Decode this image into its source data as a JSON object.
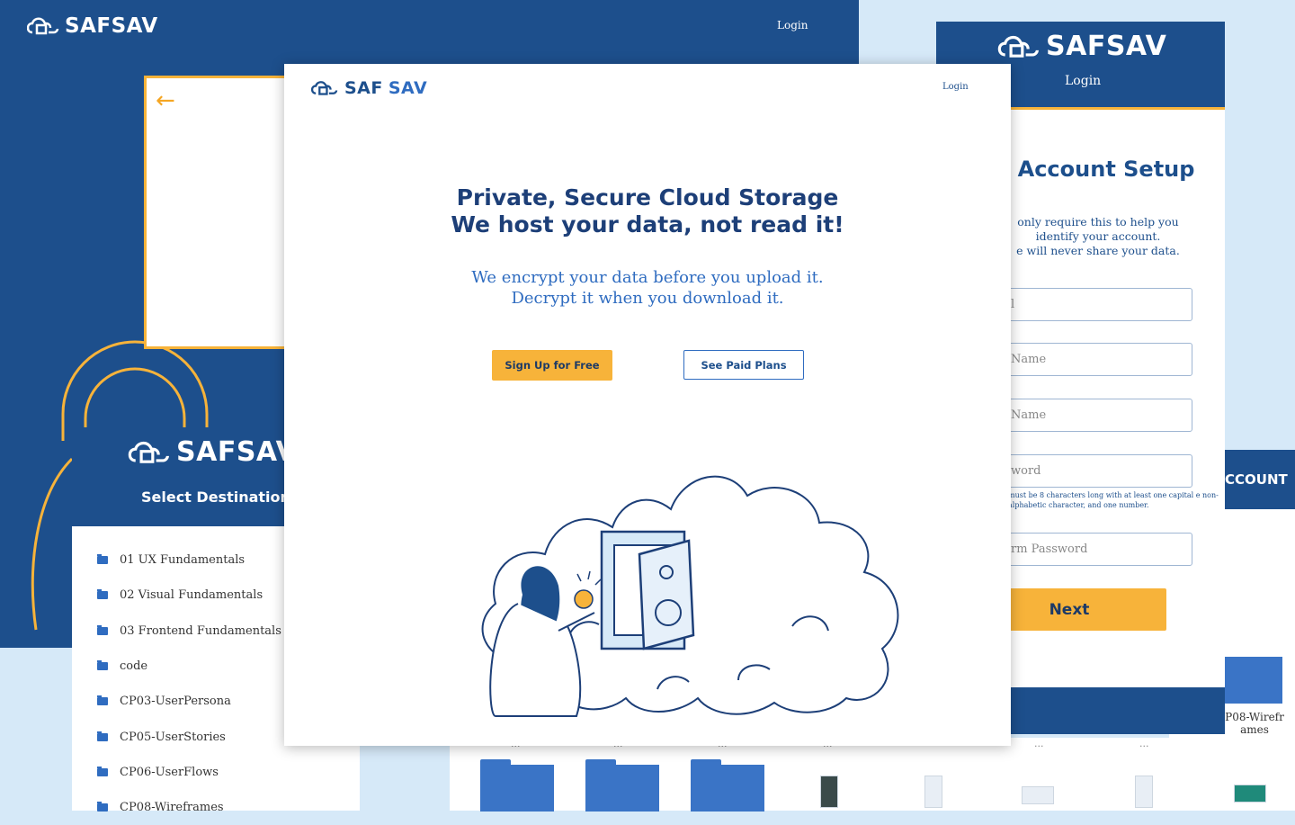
{
  "brand": {
    "name": "SAFSAV",
    "name_part1": "SAF",
    "name_part2": "SAV"
  },
  "back_panel": {
    "login_label": "Login"
  },
  "destination_panel": {
    "title": "Select Destination",
    "folders": [
      "01 UX Fundamentals",
      "02 Visual Fundamentals",
      "03 Frontend Fundamentals",
      "code",
      "CP03-UserPersona",
      "CP05-UserStories",
      "CP06-UserFlows",
      "CP08-Wireframes"
    ]
  },
  "account_setup": {
    "login_label": "Login",
    "title": "Account Setup",
    "title_visible": "e Account Setup",
    "subtitle_lines": [
      "only require this to help you",
      "identify your account.",
      "e will never share your data."
    ],
    "fields": [
      {
        "placeholder": "l"
      },
      {
        "placeholder": "Name"
      },
      {
        "placeholder": "Name"
      },
      {
        "placeholder": "word"
      },
      {
        "placeholder": "rm Password"
      }
    ],
    "password_hint": "must be 8 characters long with at least one capital e non-alphabetic character, and one number.",
    "next_label": "Next",
    "behind_header": "CCOUNT",
    "behind_folder_caption": "P08-Wirefr ames"
  },
  "main": {
    "login_label": "Login",
    "headline_line1": "Private, Secure Cloud Storage",
    "headline_line2": "We host your data, not read it!",
    "tagline_line1": "We encrypt your data before you upload it.",
    "tagline_line2": "Decrypt it when you download it.",
    "cta_primary": "Sign Up for Free",
    "cta_secondary": "See Paid Plans"
  },
  "file_strip": {
    "ellipsis": "..."
  },
  "colors": {
    "navy": "#1d4f8c",
    "accent": "#f7b33a",
    "link_blue": "#2f6cc0",
    "background": "#d6e9f8"
  }
}
